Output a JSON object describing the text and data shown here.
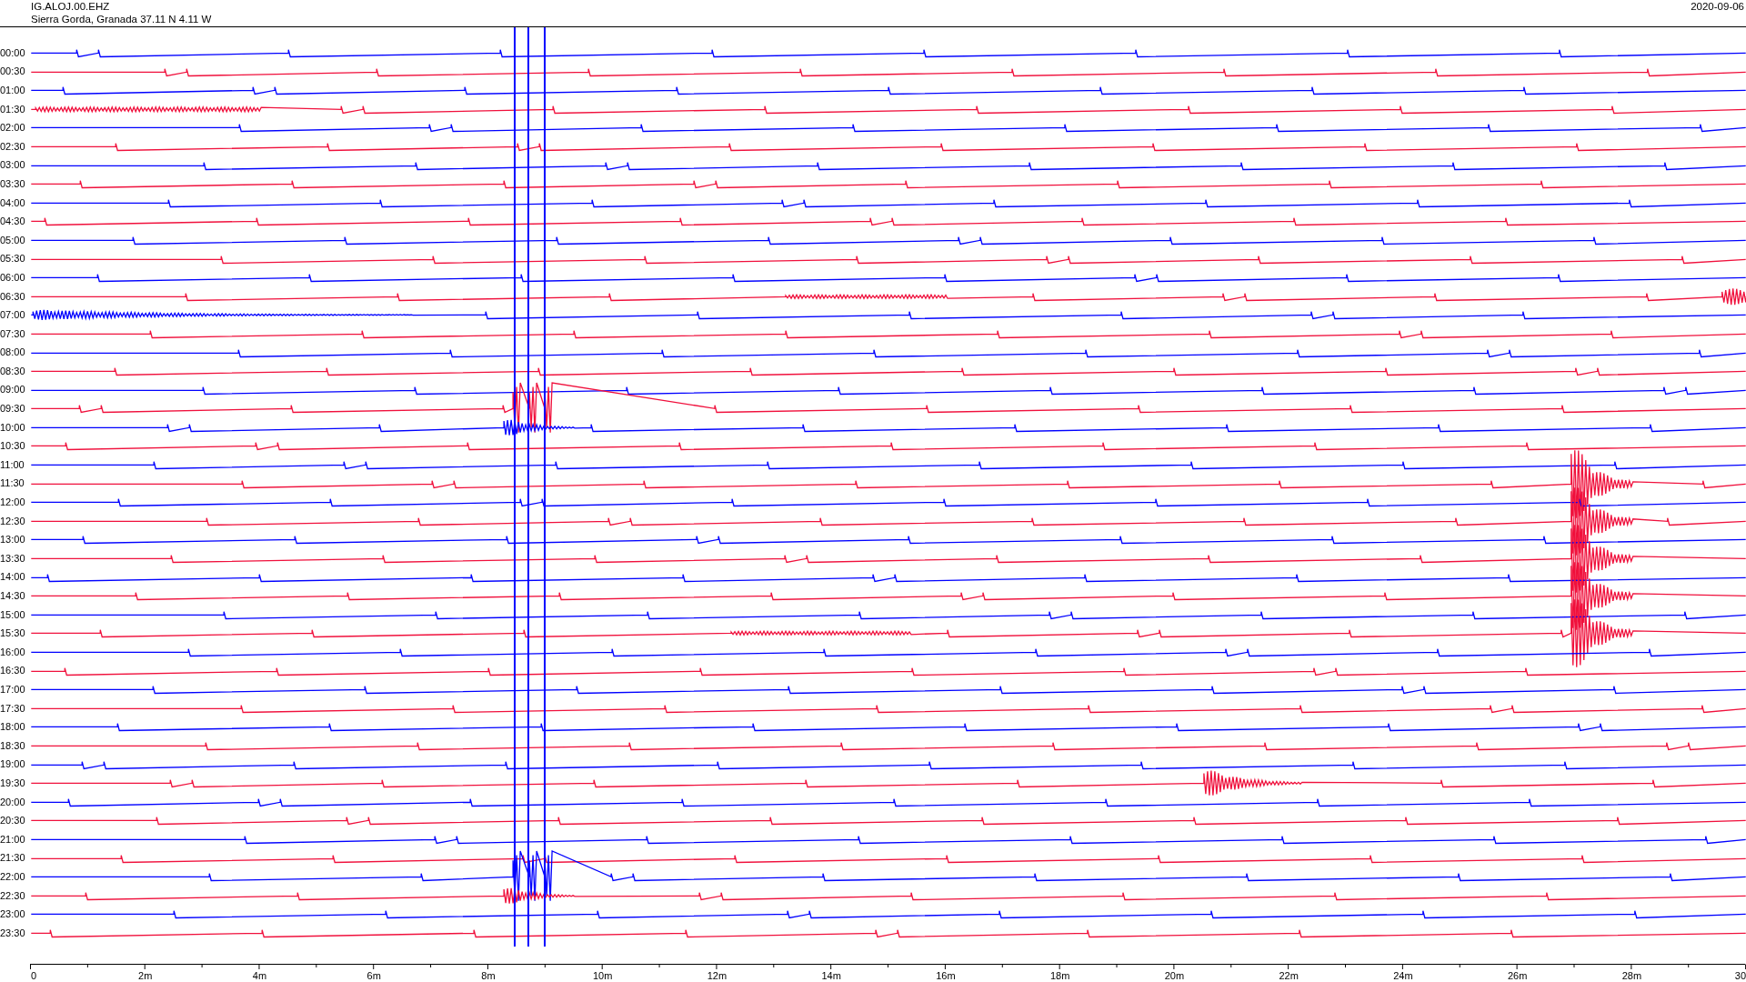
{
  "header": {
    "station": "IG.ALOJ.00.EHZ",
    "location": "Sierra Gorda, Granada  37.11 N 4.11 W",
    "date": "2020-09-06"
  },
  "rows": [
    {
      "label": "00:00",
      "color": "#0000ff"
    },
    {
      "label": "00:30",
      "color": "#f0103c"
    },
    {
      "label": "01:00",
      "color": "#0000ff"
    },
    {
      "label": "01:30",
      "color": "#f0103c"
    },
    {
      "label": "02:00",
      "color": "#0000ff"
    },
    {
      "label": "02:30",
      "color": "#f0103c"
    },
    {
      "label": "03:00",
      "color": "#0000ff"
    },
    {
      "label": "03:30",
      "color": "#f0103c"
    },
    {
      "label": "04:00",
      "color": "#0000ff"
    },
    {
      "label": "04:30",
      "color": "#f0103c"
    },
    {
      "label": "05:00",
      "color": "#0000ff"
    },
    {
      "label": "05:30",
      "color": "#f0103c"
    },
    {
      "label": "06:00",
      "color": "#0000ff"
    },
    {
      "label": "06:30",
      "color": "#f0103c"
    },
    {
      "label": "07:00",
      "color": "#0000ff"
    },
    {
      "label": "07:30",
      "color": "#f0103c"
    },
    {
      "label": "08:00",
      "color": "#0000ff"
    },
    {
      "label": "08:30",
      "color": "#f0103c"
    },
    {
      "label": "09:00",
      "color": "#0000ff"
    },
    {
      "label": "09:30",
      "color": "#f0103c"
    },
    {
      "label": "10:00",
      "color": "#0000ff"
    },
    {
      "label": "10:30",
      "color": "#f0103c"
    },
    {
      "label": "11:00",
      "color": "#0000ff"
    },
    {
      "label": "11:30",
      "color": "#f0103c"
    },
    {
      "label": "12:00",
      "color": "#0000ff"
    },
    {
      "label": "12:30",
      "color": "#f0103c"
    },
    {
      "label": "13:00",
      "color": "#0000ff"
    },
    {
      "label": "13:30",
      "color": "#f0103c"
    },
    {
      "label": "14:00",
      "color": "#0000ff"
    },
    {
      "label": "14:30",
      "color": "#f0103c"
    },
    {
      "label": "15:00",
      "color": "#0000ff"
    },
    {
      "label": "15:30",
      "color": "#f0103c"
    },
    {
      "label": "16:00",
      "color": "#0000ff"
    },
    {
      "label": "16:30",
      "color": "#f0103c"
    },
    {
      "label": "17:00",
      "color": "#0000ff"
    },
    {
      "label": "17:30",
      "color": "#f0103c"
    },
    {
      "label": "18:00",
      "color": "#0000ff"
    },
    {
      "label": "18:30",
      "color": "#f0103c"
    },
    {
      "label": "19:00",
      "color": "#0000ff"
    },
    {
      "label": "19:30",
      "color": "#f0103c"
    },
    {
      "label": "20:00",
      "color": "#0000ff"
    },
    {
      "label": "20:30",
      "color": "#f0103c"
    },
    {
      "label": "21:00",
      "color": "#0000ff"
    },
    {
      "label": "21:30",
      "color": "#f0103c"
    },
    {
      "label": "22:00",
      "color": "#0000ff"
    },
    {
      "label": "22:30",
      "color": "#f0103c"
    },
    {
      "label": "23:00",
      "color": "#0000ff"
    },
    {
      "label": "23:30",
      "color": "#f0103c"
    }
  ],
  "axis": {
    "ticks": [
      "0",
      "2m",
      "4m",
      "6m",
      "8m",
      "10m",
      "12m",
      "14m",
      "16m",
      "18m",
      "20m",
      "22m",
      "24m",
      "26m",
      "28m",
      "30"
    ]
  }
}
